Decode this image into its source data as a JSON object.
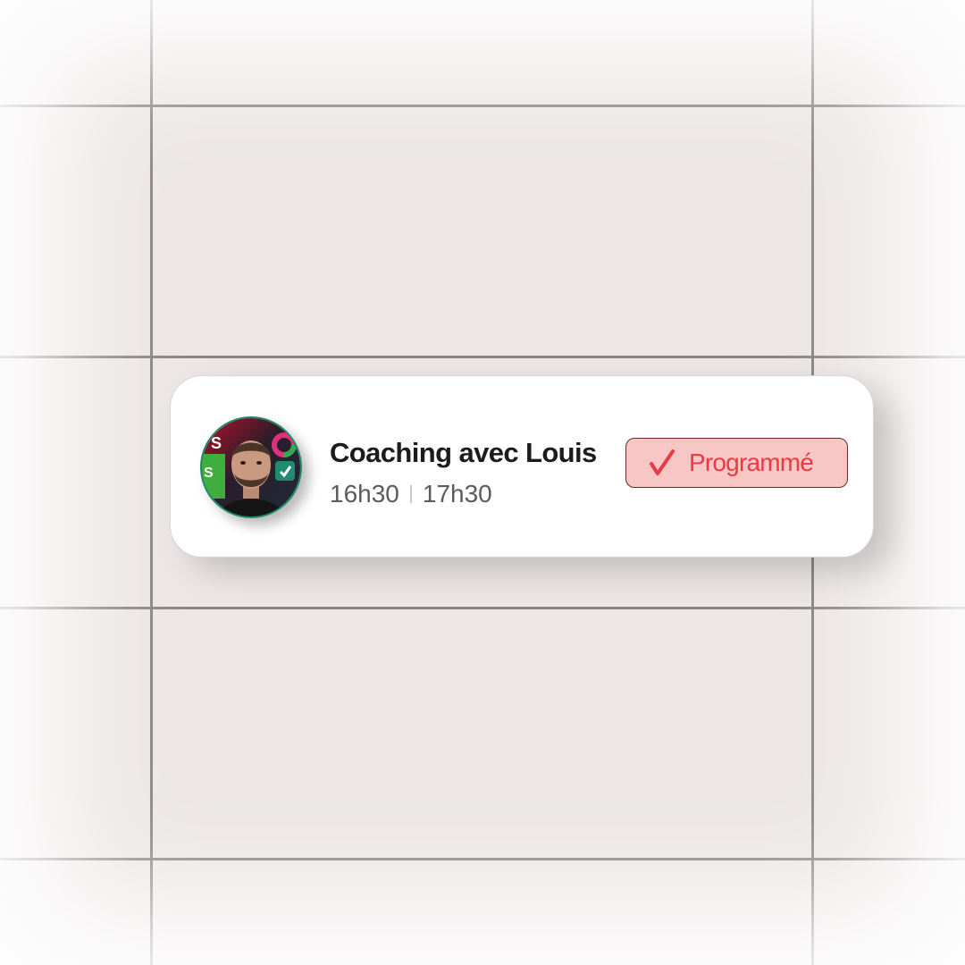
{
  "event": {
    "title": "Coaching avec Louis",
    "start_time": "16h30",
    "end_time": "17h30",
    "avatar_icon": "user-photo",
    "status": {
      "label": "Programmé",
      "icon": "check-icon",
      "text_color": "#ec3a42",
      "background_color": "#f9c6c6"
    }
  },
  "colors": {
    "background": "#ece7e6",
    "grid_lines": "#8a8687",
    "card": "#ffffff"
  }
}
